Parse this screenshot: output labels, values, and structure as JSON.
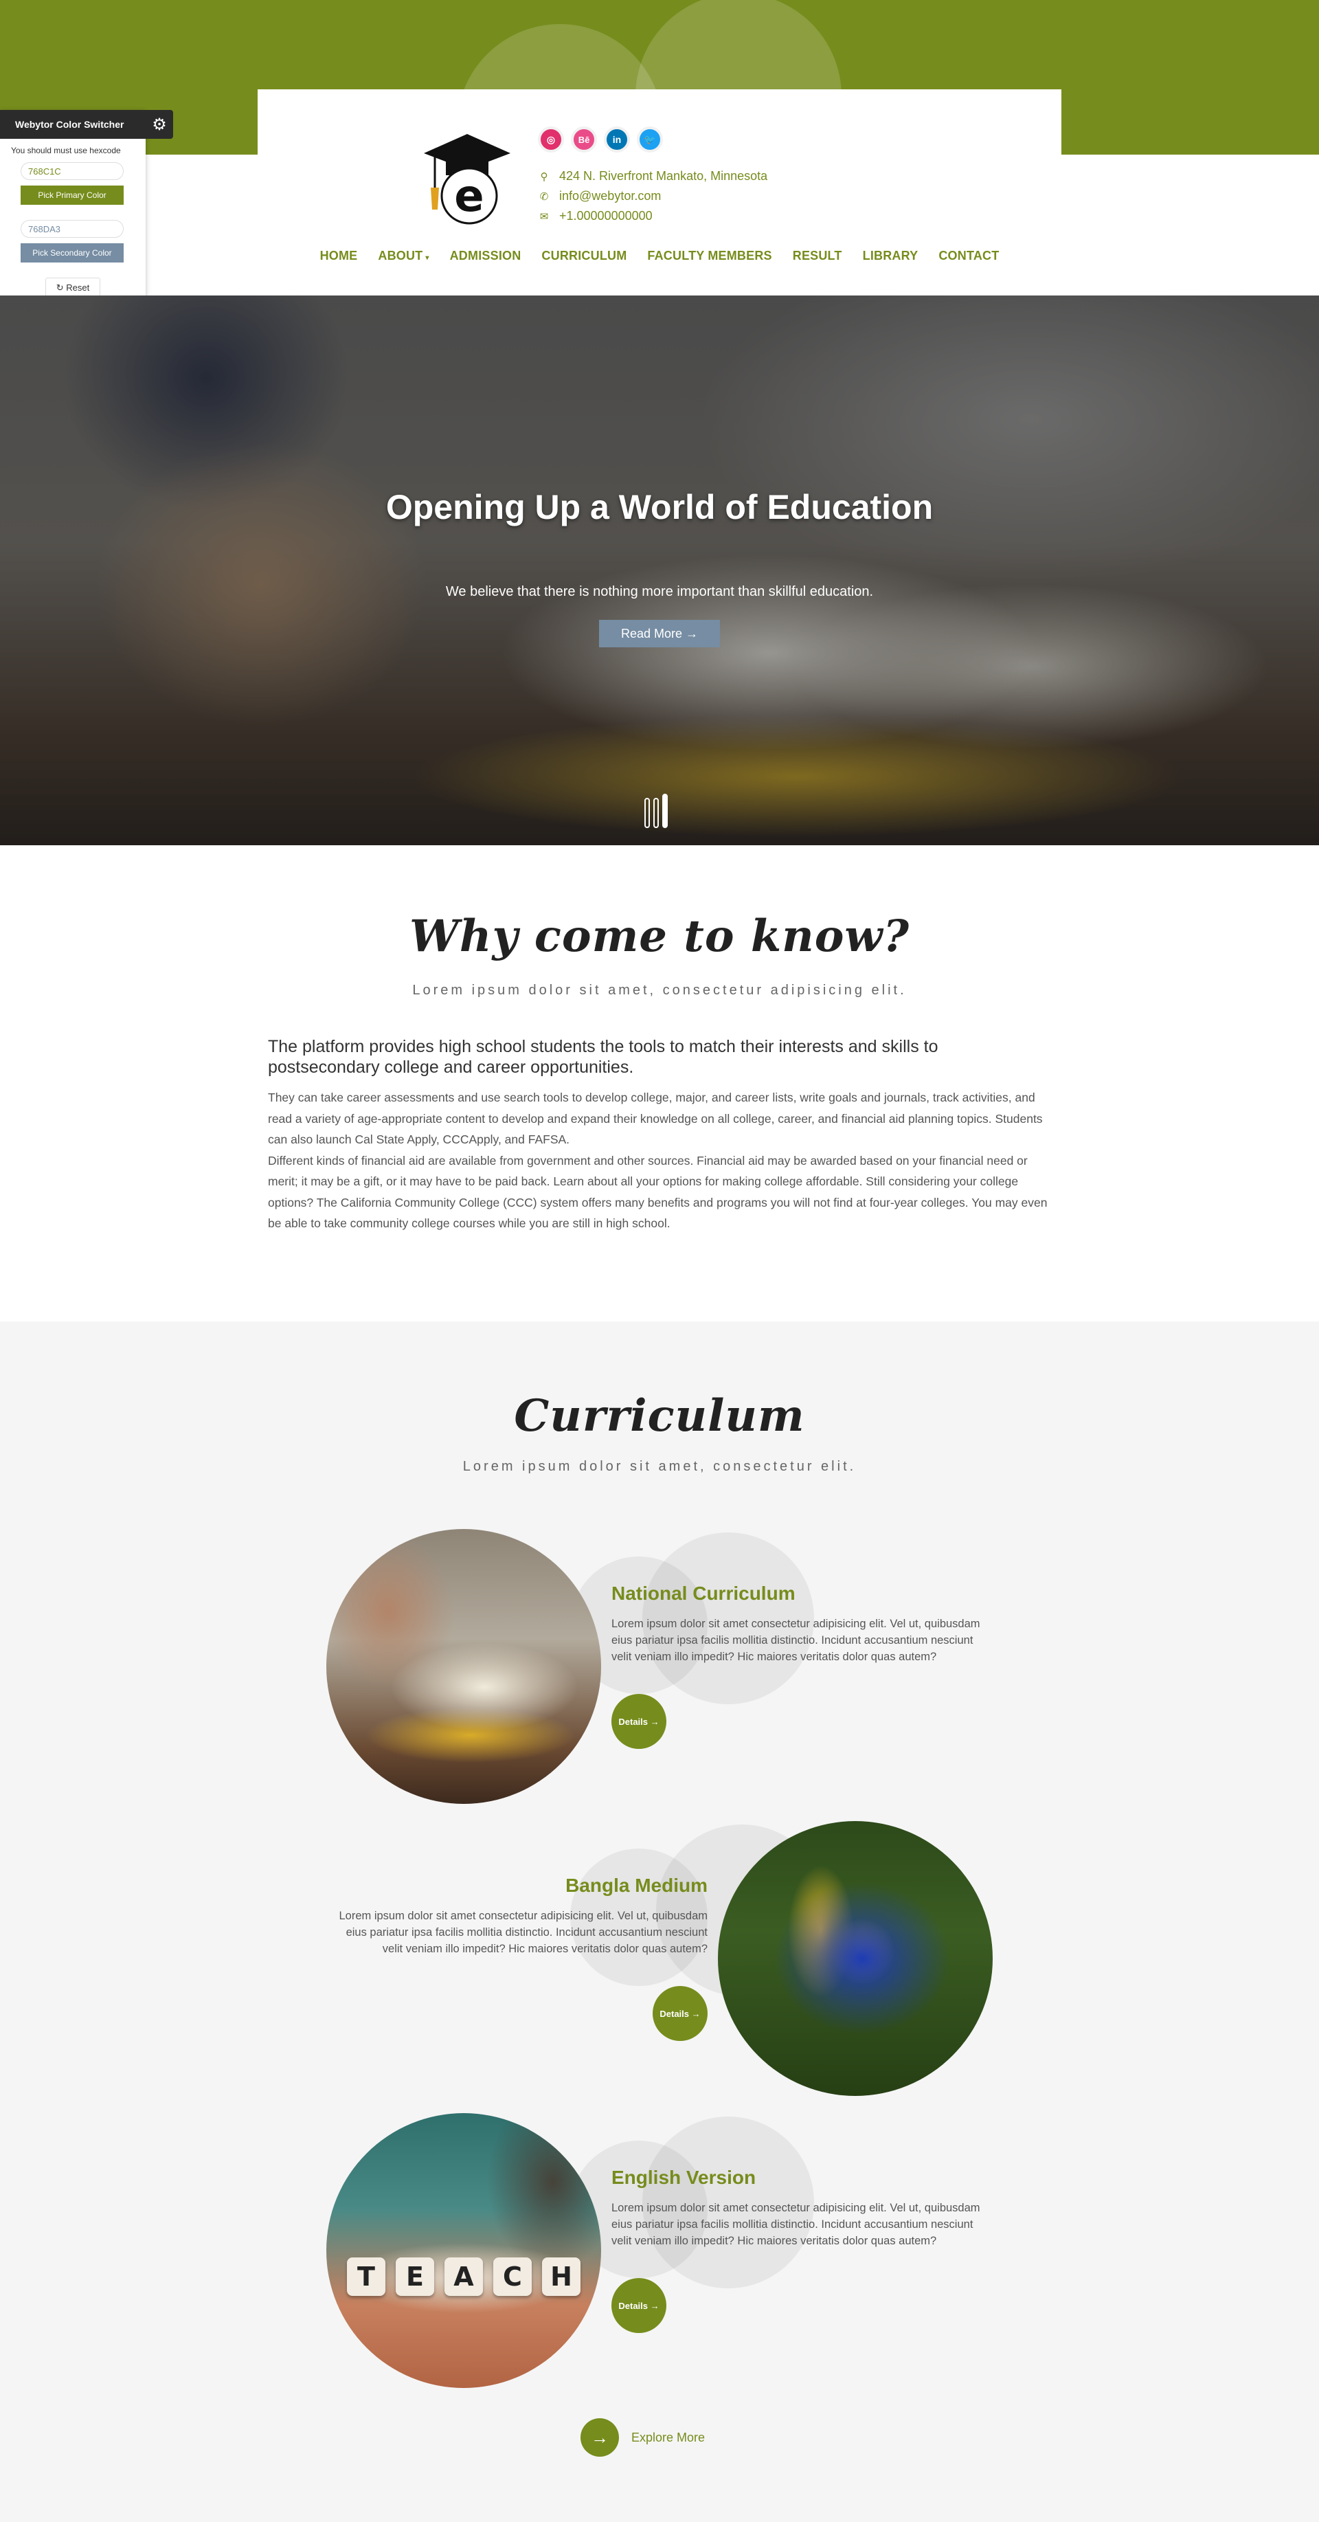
{
  "colors": {
    "primary": "#768C1C",
    "secondary": "#768DA3",
    "section_bg": "#f5f5f5"
  },
  "color_switcher": {
    "title": "Webytor Color Switcher",
    "note": "You should must use hexcode",
    "primary_value": "768C1C",
    "primary_button": "Pick Primary Color",
    "secondary_value": "768DA3",
    "secondary_button": "Pick Secondary Color",
    "reset": "Reset",
    "icon": "gear-icon"
  },
  "header": {
    "logo_letter": "e",
    "socials": [
      {
        "name": "instagram",
        "glyph": "◎"
      },
      {
        "name": "behance",
        "glyph": "Bē"
      },
      {
        "name": "linkedin",
        "glyph": "in"
      },
      {
        "name": "twitter",
        "glyph": "🐦"
      }
    ],
    "address": "424 N. Riverfront Mankato, Minnesota",
    "email": "info@webytor.com",
    "phone": "+1.00000000000"
  },
  "nav": {
    "items": [
      {
        "label": "HOME"
      },
      {
        "label": "ABOUT",
        "has_dropdown": true
      },
      {
        "label": "ADMISSION"
      },
      {
        "label": "CURRICULUM"
      },
      {
        "label": "FACULTY MEMBERS"
      },
      {
        "label": "RESULT"
      },
      {
        "label": "LIBRARY"
      },
      {
        "label": "CONTACT"
      }
    ]
  },
  "hero": {
    "title": "Opening Up a World of Education",
    "subtitle": "We believe that there is nothing more important than skillful education.",
    "button": "Read More →",
    "slides": 3,
    "active_slide": 3
  },
  "why": {
    "title": "Why come to know?",
    "subtitle": "Lorem ipsum dolor sit amet, consectetur adipisicing elit.",
    "lead": "The platform provides high school students the tools to match their interests and skills to postsecondary college and career opportunities.",
    "paragraph1": "They can take career assessments and use search tools to develop college, major, and career lists, write goals and journals, track activities, and read a variety of age-appropriate content to develop and expand their knowledge on all college, career, and financial aid planning topics. Students can also launch Cal State Apply, CCCApply, and FAFSA.",
    "paragraph2": "Different kinds of financial aid are available from government and other sources. Financial aid may be awarded based on your financial need or merit; it may be a gift, or it may have to be paid back. Learn about all your options for making college affordable. Still considering your college options? The California Community College (CCC) system offers many benefits and programs you will not find at four-year colleges. You may even be able to take community college courses while you are still in high school."
  },
  "curriculum": {
    "title": "Curriculum",
    "subtitle": "Lorem ipsum dolor sit amet, consectetur elit.",
    "items": [
      {
        "title": "National Curriculum",
        "text": "Lorem ipsum dolor sit amet consectetur adipisicing elit. Vel ut, quibusdam eius pariatur ipsa facilis mollitia distinctio. Incidunt accusantium nesciunt velit veniam illo impedit? Hic maiores veritatis dolor quas autem?",
        "button": "Details →"
      },
      {
        "title": "Bangla Medium",
        "text": "Lorem ipsum dolor sit amet consectetur adipisicing elit. Vel ut, quibusdam eius pariatur ipsa facilis mollitia distinctio. Incidunt accusantium nesciunt velit veniam illo impedit? Hic maiores veritatis dolor quas autem?",
        "button": "Details →"
      },
      {
        "title": "English Version",
        "text": "Lorem ipsum dolor sit amet consectetur adipisicing elit. Vel ut, quibusdam eius pariatur ipsa facilis mollitia distinctio. Incidunt accusantium nesciunt velit veniam illo impedit? Hic maiores veritatis dolor quas autem?",
        "button": "Details →",
        "image_text": "TEACH"
      }
    ],
    "explore": "Explore More"
  }
}
